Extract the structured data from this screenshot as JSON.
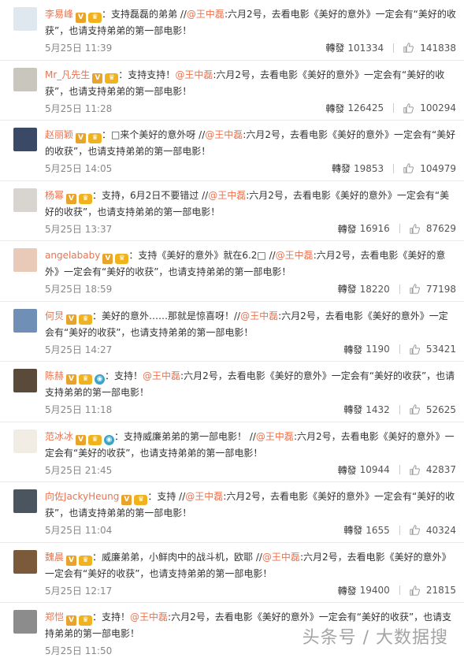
{
  "comments": [
    {
      "user": "李易峰",
      "pre": "：支持磊磊的弟弟 //",
      "mention": "@王中磊",
      "post": ":六月2号，去看电影《美好的意外》一定会有“美好的收获”，也请支持弟弟的第一部电影！",
      "time": "5月25日 11:39",
      "repost_label": "轉發",
      "reposts": "101334",
      "likes": "141838",
      "avatar_color": "#dfe7ef"
    },
    {
      "user": "Mr_凡先生",
      "pre": "：支持支持！",
      "mention": "@王中磊",
      "post": ":六月2号，去看电影《美好的意外》一定会有“美好的收获”，也请支持弟弟的第一部电影！",
      "time": "5月25日 11:28",
      "repost_label": "轉發",
      "reposts": "126425",
      "likes": "100294",
      "avatar_color": "#c9c6bd"
    },
    {
      "user": "赵丽颖",
      "pre": "：□来个美好的意外呀 //",
      "mention": "@王中磊",
      "post": ":六月2号，去看电影《美好的意外》一定会有“美好的收获”，也请支持弟弟的第一部电影！",
      "time": "5月25日 14:05",
      "repost_label": "轉發",
      "reposts": "19853",
      "likes": "104979",
      "avatar_color": "#3a4a66"
    },
    {
      "user": "杨幂",
      "pre": "：支持，6月2日不要错过 //",
      "mention": "@王中磊",
      "post": ":六月2号，去看电影《美好的意外》一定会有“美好的收获”，也请支持弟弟的第一部电影！",
      "time": "5月25日 13:37",
      "repost_label": "轉發",
      "reposts": "16916",
      "likes": "87629",
      "avatar_color": "#d8d4d0"
    },
    {
      "user": "angelababy",
      "pre": "：支持《美好的意外》就在6.2□ //",
      "mention": "@王中磊",
      "post": ":六月2号，去看电影《美好的意外》一定会有“美好的收获”，也请支持弟弟的第一部电影！",
      "time": "5月25日 18:59",
      "repost_label": "轉發",
      "reposts": "18220",
      "likes": "77198",
      "avatar_color": "#e9c9b8"
    },
    {
      "user": "何炅",
      "pre": "：美好的意外……那就是惊喜呀！//",
      "mention": "@王中磊",
      "post": ":六月2号，去看电影《美好的意外》一定会有“美好的收获”，也请支持弟弟的第一部电影！",
      "time": "5月25日 14:27",
      "repost_label": "轉發",
      "reposts": "1190",
      "likes": "53421",
      "avatar_color": "#6f8fb7"
    },
    {
      "user": "陈赫",
      "pre": "：支持！",
      "mention": "@王中磊",
      "post": ":六月2号，去看电影《美好的意外》一定会有“美好的收获”，也请支持弟弟的第一部电影！",
      "time": "5月25日 11:18",
      "repost_label": "轉發",
      "reposts": "1432",
      "likes": "52625",
      "avatar_color": "#5a4a3a"
    },
    {
      "user": "范冰冰",
      "pre": "：支持威廉弟弟的第一部电影！ //",
      "mention": "@王中磊",
      "post": ":六月2号，去看电影《美好的意外》一定会有“美好的收获”，也请支持弟弟的第一部电影！",
      "time": "5月25日 21:45",
      "repost_label": "轉發",
      "reposts": "10944",
      "likes": "42837",
      "avatar_color": "#f1ece4"
    },
    {
      "user": "向佐JackyHeung",
      "pre": "：支持 //",
      "mention": "@王中磊",
      "post": ":六月2号，去看电影《美好的意外》一定会有“美好的收获”，也请支持弟弟的第一部电影！",
      "time": "5月25日 11:04",
      "repost_label": "轉發",
      "reposts": "1655",
      "likes": "40324",
      "avatar_color": "#4b5560"
    },
    {
      "user": "魏晨",
      "pre": "：威廉弟弟，小鲜肉中的战斗机，欧耶 //",
      "mention": "@王中磊",
      "post": ":六月2号，去看电影《美好的意外》一定会有“美好的收获”，也请支持弟弟的第一部电影！",
      "time": "5月25日 12:17",
      "repost_label": "轉發",
      "reposts": "19400",
      "likes": "21815",
      "avatar_color": "#7a5a3a"
    },
    {
      "user": "郑恺",
      "pre": "：支持！",
      "mention": "@王中磊",
      "post": ":六月2号，去看电影《美好的意外》一定会有“美好的收获”，也请支持弟弟的第一部电影！",
      "time": "5月25日 11:50",
      "repost_label": "",
      "reposts": "",
      "likes": "",
      "avatar_color": "#8c8c8c"
    }
  ],
  "watermark": "头条号 / 大数据搜"
}
